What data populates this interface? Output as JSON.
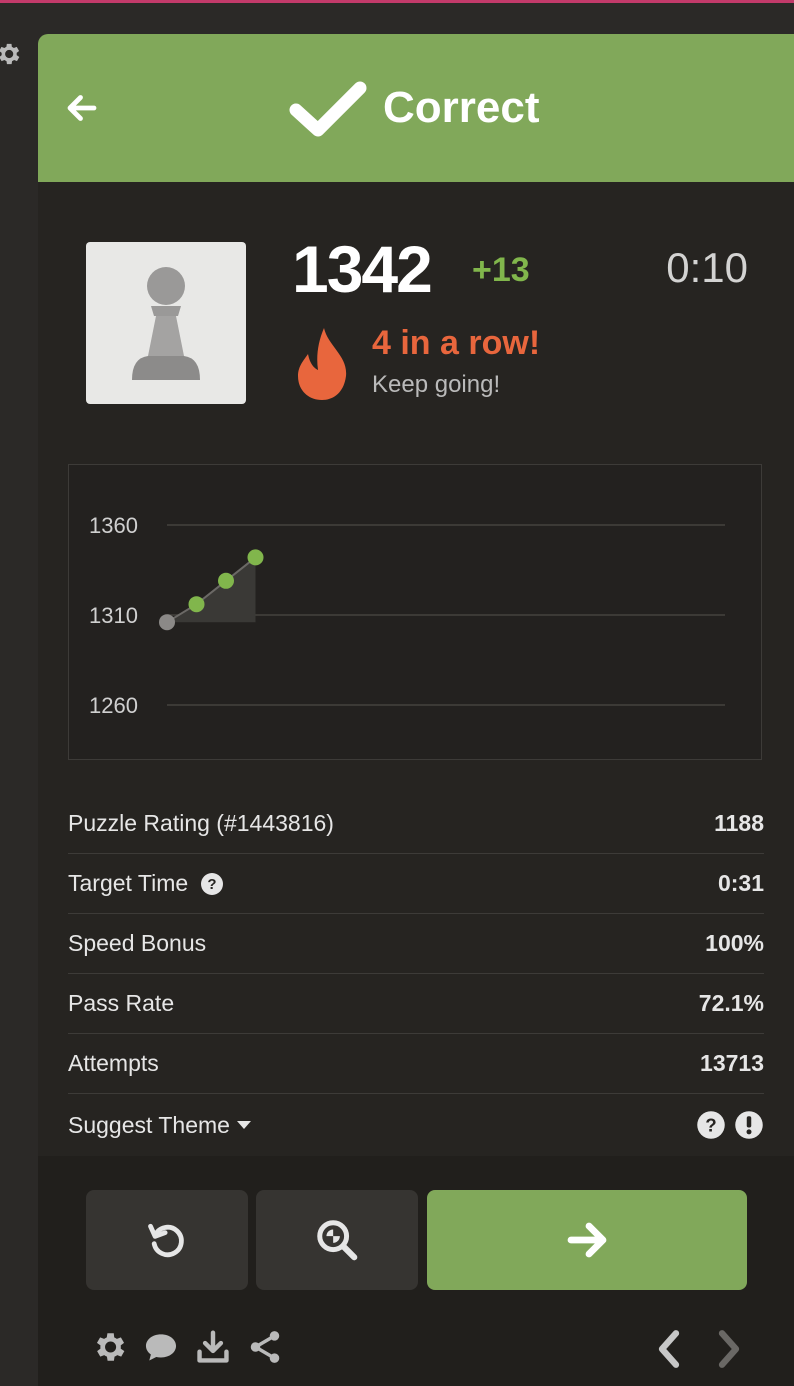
{
  "header": {
    "title": "Correct"
  },
  "result": {
    "rating": "1342",
    "delta": "+13",
    "time": "0:10",
    "streak": "4 in a row!",
    "streak_sub": "Keep going!"
  },
  "chart_data": {
    "type": "line",
    "x": [
      1,
      2,
      3,
      4
    ],
    "values": [
      1306,
      1316,
      1329,
      1342
    ],
    "yticks": [
      1260,
      1310,
      1360
    ],
    "ylim": [
      1260,
      1360
    ],
    "colors": {
      "first_point": "#8b8987",
      "points": "#81b64c",
      "line": "#6b6966"
    }
  },
  "stats": {
    "puzzle_rating_label": "Puzzle Rating (#1443816)",
    "puzzle_rating_value": "1188",
    "target_time_label": "Target Time",
    "target_time_value": "0:31",
    "speed_bonus_label": "Speed Bonus",
    "speed_bonus_value": "100%",
    "pass_rate_label": "Pass Rate",
    "pass_rate_value": "72.1%",
    "attempts_label": "Attempts",
    "attempts_value": "13713",
    "suggest_theme_label": "Suggest Theme"
  },
  "icons": {
    "back": "arrow-left-icon",
    "check": "check-icon",
    "avatar": "pawn-icon",
    "streak": "flame-icon",
    "help": "question-circle-icon",
    "report": "exclamation-circle-icon",
    "retry": "retry-icon",
    "analyze": "magnify-icon",
    "next": "arrow-right-icon",
    "settings": "gear-icon",
    "chat": "chat-icon",
    "download": "download-icon",
    "share": "share-icon",
    "prev": "chevron-left-icon",
    "forward": "chevron-right-icon"
  },
  "colors": {
    "accent_green": "#81a85a",
    "delta_green": "#81b64c",
    "streak_orange": "#e8663d",
    "panel_bg": "#262421"
  }
}
